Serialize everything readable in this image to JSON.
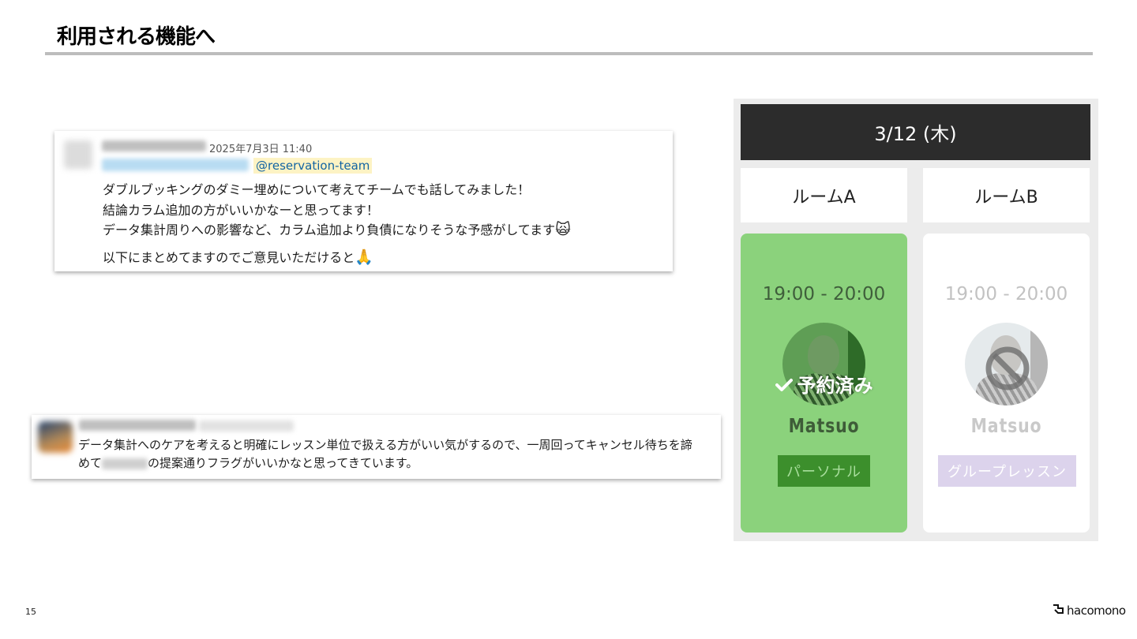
{
  "slide": {
    "title": "利用される機能へ",
    "page_number": "15",
    "logo_text": "hacomono"
  },
  "message1": {
    "timestamp": "2025年7月3日 11:40",
    "mention": "@reservation-team",
    "lines": [
      "ダブルブッキングのダミー埋めについて考えてチームでも話してみました！",
      "結論カラム追加の方がいいかなーと思ってます！",
      "データ集計周りへの影響など、カラム追加より負債になりそうな予感がしてます",
      "以下にまとめてますのでご意見いただけると"
    ],
    "emoji1": "🙀",
    "emoji2": "🙏"
  },
  "message2": {
    "line1": "データ集計へのケアを考えると明確にレッスン単位で扱える方がいい気がするので、一周回ってキャンセル待ちを諦",
    "line2_prefix": "めて",
    "line2_suffix": "の提案通りフラグがいいかなと思ってきています。"
  },
  "reservation": {
    "date": "3/12 (木)",
    "rooms": [
      {
        "name": "ルームA",
        "time": "19:00 - 20:00",
        "status": "予約済み",
        "instructor": "Matsuo",
        "lesson_type": "パーソナル",
        "slot_color": "#8bd27c"
      },
      {
        "name": "ルームB",
        "time": "19:00 - 20:00",
        "instructor": "Matsuo",
        "lesson_type": "グループレッスン",
        "slot_color": "#ffffff"
      }
    ],
    "icons": {
      "reserved": "check-icon",
      "unavailable": "ban-icon"
    }
  }
}
